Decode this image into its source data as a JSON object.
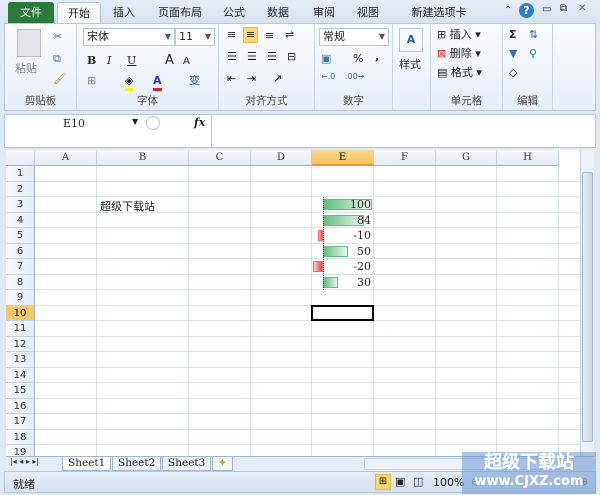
{
  "tabs": [
    "文件",
    "开始",
    "插入",
    "页面布局",
    "公式",
    "数据",
    "审阅",
    "视图",
    "新建选项卡"
  ],
  "clipboard": {
    "paste": "粘贴",
    "label": "剪贴板"
  },
  "font": {
    "name": "宋体",
    "size": "11",
    "label": "字体",
    "bold": "B",
    "italic": "I",
    "underline": "U"
  },
  "alignment": {
    "label": "对齐方式"
  },
  "number": {
    "format": "常规",
    "label": "数字",
    "percent": "%",
    "comma": ","
  },
  "styles": {
    "label": "样式"
  },
  "cells": {
    "insert": "插入",
    "delete": "删除",
    "format": "格式",
    "label": "单元格"
  },
  "editing": {
    "label": "编辑",
    "sum": "Σ"
  },
  "formula_bar": {
    "name_box": "E10",
    "fx": "fx",
    "value": ""
  },
  "columns": [
    "A",
    "B",
    "C",
    "D",
    "E",
    "F",
    "G",
    "H"
  ],
  "selected_column": "E",
  "rows": [
    "1",
    "2",
    "3",
    "4",
    "5",
    "6",
    "7",
    "8",
    "9",
    "10",
    "11",
    "12",
    "13",
    "14",
    "15",
    "16",
    "17",
    "18",
    "19"
  ],
  "selected_row": "10",
  "cells_data": {
    "B3": "超级下载站",
    "E3": "100",
    "E4": "84",
    "E5": "-10",
    "E6": "50",
    "E7": "-20",
    "E8": "30"
  },
  "databar_values": [
    100,
    84,
    -10,
    50,
    -20,
    30
  ],
  "sheets": [
    "Sheet1",
    "Sheet2",
    "Sheet3"
  ],
  "active_sheet": "Sheet1",
  "status": {
    "ready": "就绪",
    "zoom": "100%"
  },
  "watermark": {
    "line1": "超级下载站",
    "line2": "www.CJXZ.com"
  }
}
